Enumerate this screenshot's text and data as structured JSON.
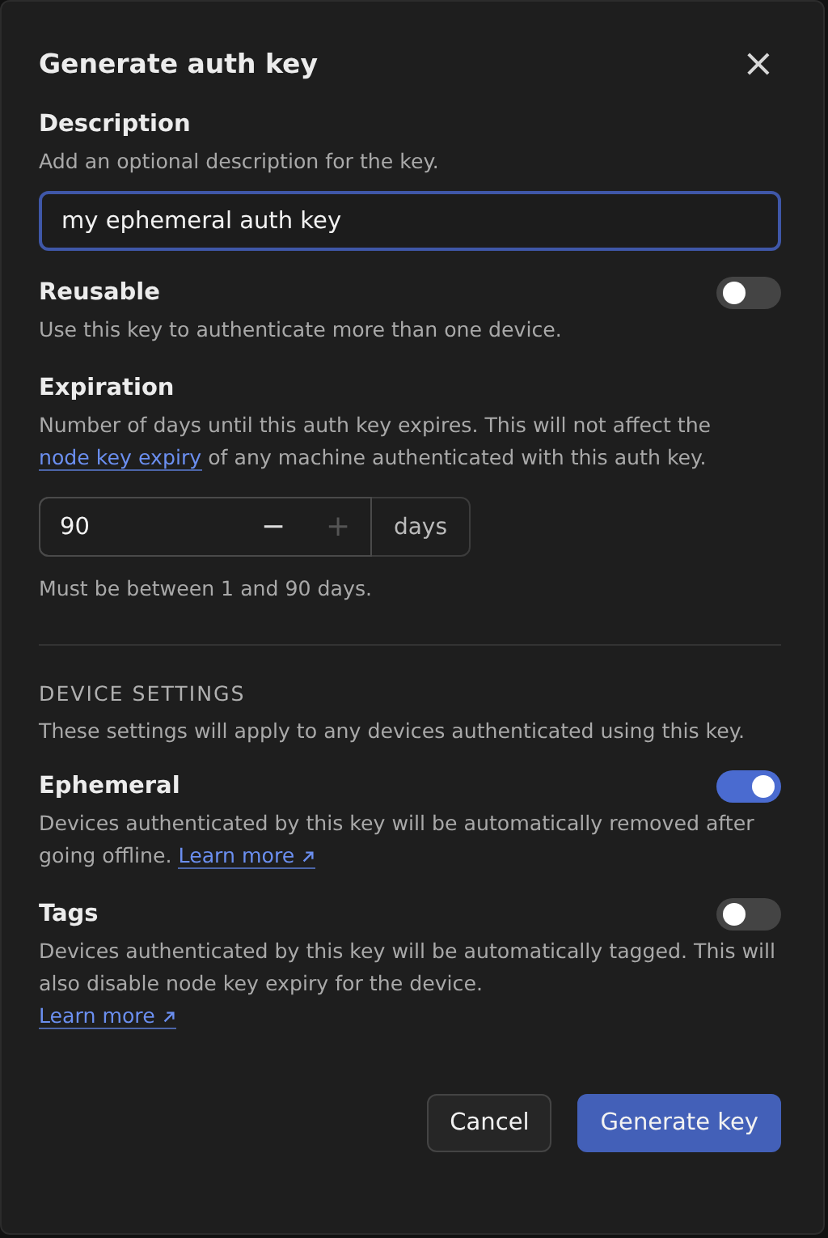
{
  "dialog": {
    "title": "Generate auth key",
    "close": "×"
  },
  "description": {
    "label": "Description",
    "help": "Add an optional description for the key.",
    "value": "my ephemeral auth key",
    "focused": true
  },
  "reusable": {
    "label": "Reusable",
    "help": "Use this key to authenticate more than one device.",
    "on": false
  },
  "expiration": {
    "label": "Expiration",
    "help_before": "Number of days until this auth key expires. This will not affect the ",
    "help_link": "node key expiry",
    "help_after": " of any machine authenticated with this auth key.",
    "value": "90",
    "decrement": {
      "label": "−",
      "disabled": false
    },
    "increment": {
      "label": "+",
      "disabled": true
    },
    "unit": "days",
    "hint": "Must be between 1 and 90 days."
  },
  "device_settings": {
    "heading": "DEVICE SETTINGS",
    "help": "These settings will apply to any devices authenticated using this key.",
    "items": [
      {
        "label": "Ephemeral",
        "help": "Devices authenticated by this key will be automatically removed after going offline.",
        "link": "Learn more",
        "link_on_new_line": false,
        "on": true
      },
      {
        "label": "Tags",
        "help": "Devices authenticated by this key will be automatically tagged. This will also disable node key expiry for the device.",
        "link": "Learn more",
        "link_on_new_line": true,
        "on": false
      }
    ]
  },
  "buttons": [
    {
      "label": "Cancel",
      "kind": "secondary"
    },
    {
      "label": "Generate key",
      "kind": "primary"
    }
  ]
}
